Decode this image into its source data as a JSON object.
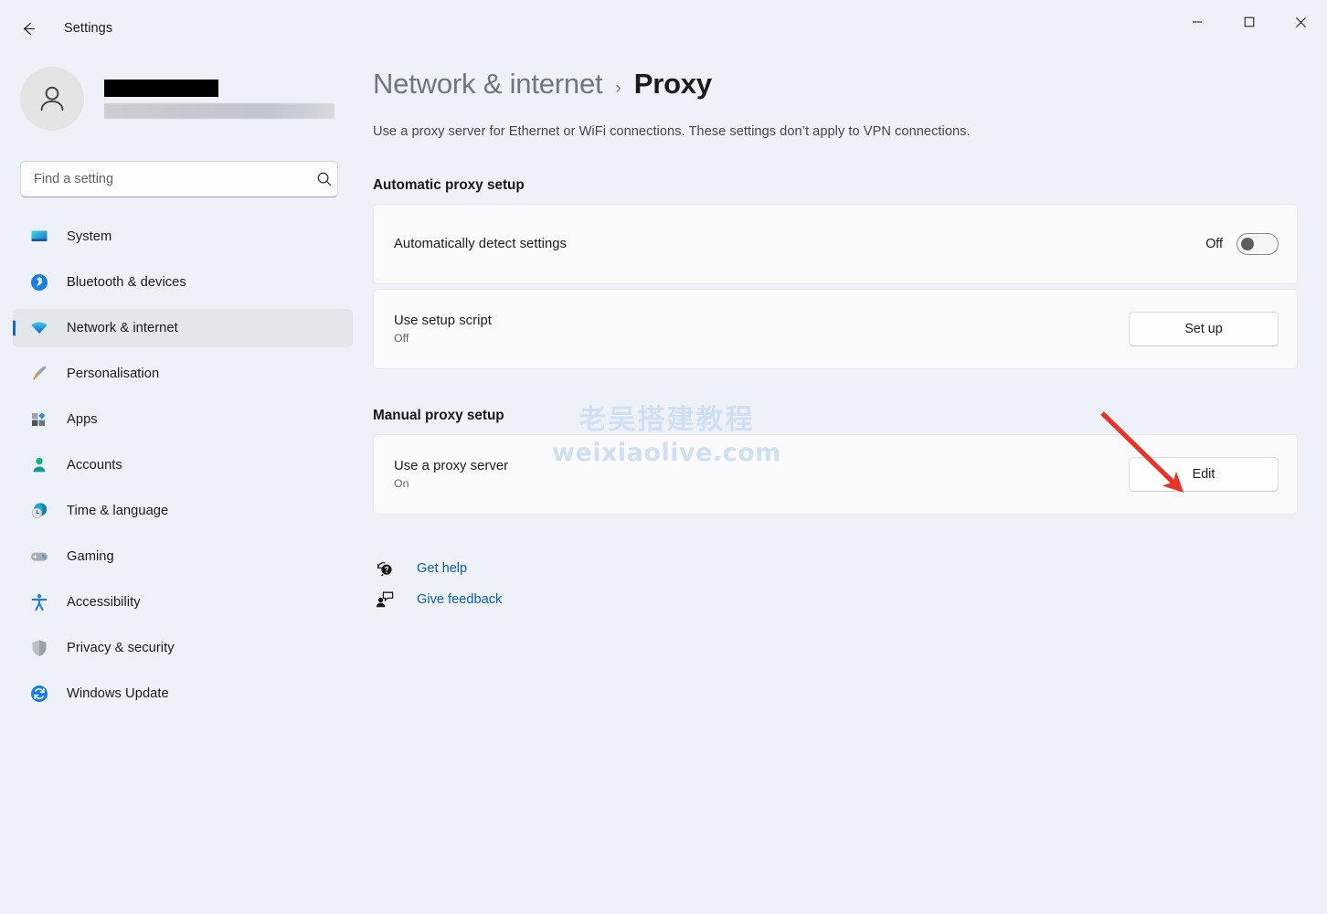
{
  "window": {
    "app_title": "Settings",
    "back_icon": "arrow-left-icon",
    "controls": {
      "minimize": "minimize-icon",
      "maximize": "maximize-icon",
      "close": "close-icon"
    }
  },
  "sidebar": {
    "profile": {
      "avatar_icon": "person-avatar-icon",
      "name": "",
      "email": ""
    },
    "search": {
      "placeholder": "Find a setting",
      "value": "",
      "icon": "search-icon"
    },
    "items": [
      {
        "label": "System",
        "icon": "system-icon",
        "selected": false
      },
      {
        "label": "Bluetooth & devices",
        "icon": "bluetooth-icon",
        "selected": false
      },
      {
        "label": "Network & internet",
        "icon": "wifi-icon",
        "selected": true
      },
      {
        "label": "Personalisation",
        "icon": "paintbrush-icon",
        "selected": false
      },
      {
        "label": "Apps",
        "icon": "apps-icon",
        "selected": false
      },
      {
        "label": "Accounts",
        "icon": "accounts-icon",
        "selected": false
      },
      {
        "label": "Time & language",
        "icon": "clock-globe-icon",
        "selected": false
      },
      {
        "label": "Gaming",
        "icon": "gamepad-icon",
        "selected": false
      },
      {
        "label": "Accessibility",
        "icon": "accessibility-icon",
        "selected": false
      },
      {
        "label": "Privacy & security",
        "icon": "shield-icon",
        "selected": false
      },
      {
        "label": "Windows Update",
        "icon": "update-refresh-icon",
        "selected": false
      }
    ]
  },
  "main": {
    "breadcrumb": {
      "parent": "Network & internet",
      "separator": "›",
      "current": "Proxy"
    },
    "description": "Use a proxy server for Ethernet or WiFi connections. These settings don’t apply to VPN connections.",
    "automatic_section": {
      "heading": "Automatic proxy setup",
      "detect": {
        "title": "Automatically detect settings",
        "toggle_state_label": "Off",
        "toggle_on": false
      },
      "setup_script": {
        "title": "Use setup script",
        "subtitle": "Off",
        "button_label": "Set up"
      }
    },
    "manual_section": {
      "heading": "Manual proxy setup",
      "proxy_server": {
        "title": "Use a proxy server",
        "subtitle": "On",
        "button_label": "Edit"
      }
    },
    "links": [
      {
        "label": "Get help",
        "icon": "help-question-bubble-icon"
      },
      {
        "label": "Give feedback",
        "icon": "feedback-person-bubble-icon"
      }
    ]
  },
  "watermark": {
    "line1": "老吴搭建教程",
    "line2": "weixiaolive.com",
    "color": "#cfe0f2"
  },
  "annotation": {
    "type": "arrow",
    "color": "#e8342a",
    "points_to": "Edit"
  },
  "colors": {
    "page_background": "#eef2f8",
    "card_background": "#fbfbfd",
    "accent": "#0f6cbd",
    "link": "#0a5bb5",
    "selected_nav_background": "#e3e6ea"
  }
}
